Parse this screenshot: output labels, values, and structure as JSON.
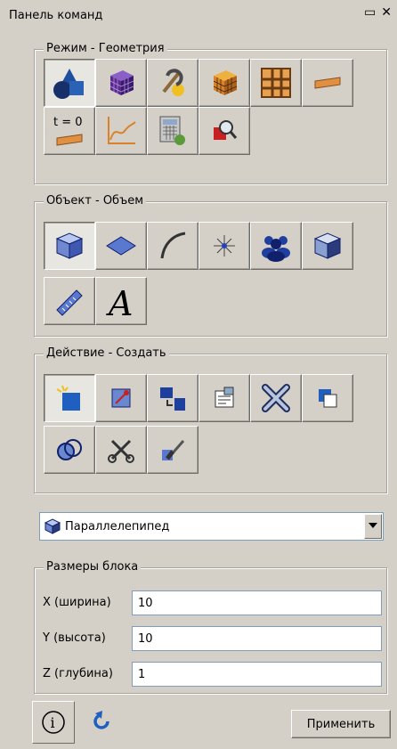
{
  "panel": {
    "title": "Панель команд",
    "float_icon": "dock-float-icon",
    "close_icon": "close-icon"
  },
  "mode_group": {
    "legend": "Режим - Геометрия",
    "buttons": [
      {
        "icon": "geometry-shapes-icon",
        "pressed": true
      },
      {
        "icon": "mesh-cube-icon"
      },
      {
        "icon": "boundary-conditions-icon"
      },
      {
        "icon": "orange-mesh-cube-icon"
      },
      {
        "icon": "grid-frame-icon"
      },
      {
        "icon": "material-plate-icon"
      },
      {
        "icon": "time-zero-icon",
        "label": "t = 0"
      },
      {
        "icon": "plot-chart-icon"
      },
      {
        "icon": "calculator-settings-icon"
      },
      {
        "icon": "zoom-inspect-icon"
      }
    ]
  },
  "object_group": {
    "legend": "Объект - Объем",
    "buttons": [
      {
        "icon": "volume-cube-icon",
        "pressed": true
      },
      {
        "icon": "surface-icon"
      },
      {
        "icon": "curve-icon"
      },
      {
        "icon": "vertex-icon"
      },
      {
        "icon": "group-icon"
      },
      {
        "icon": "shaded-cube-icon"
      },
      {
        "icon": "ruler-icon"
      },
      {
        "icon": "text-a-icon",
        "label": "A"
      }
    ]
  },
  "action_group": {
    "legend": "Действие - Создать",
    "buttons": [
      {
        "icon": "create-icon",
        "pressed": true
      },
      {
        "icon": "modify-icon"
      },
      {
        "icon": "move-icon"
      },
      {
        "icon": "properties-icon"
      },
      {
        "icon": "delete-x-icon"
      },
      {
        "icon": "copy-icon"
      },
      {
        "icon": "boolean-icon"
      },
      {
        "icon": "cut-scissors-icon"
      },
      {
        "icon": "cleanup-brush-icon"
      }
    ]
  },
  "shape_select": {
    "value": "Параллелепипед",
    "icon": "box-icon"
  },
  "dims_group": {
    "legend": "Размеры блока",
    "fields": [
      {
        "label": "X (ширина)",
        "value": "10"
      },
      {
        "label": "Y (высота)",
        "value": "10"
      },
      {
        "label": "Z (глубина)",
        "value": "1"
      }
    ]
  },
  "footer": {
    "info_label": "i",
    "apply_label": "Применить"
  },
  "colors": {
    "panel_bg": "#d4d0c8",
    "accent_blue": "#1f5fbf",
    "orange": "#d9822b"
  }
}
